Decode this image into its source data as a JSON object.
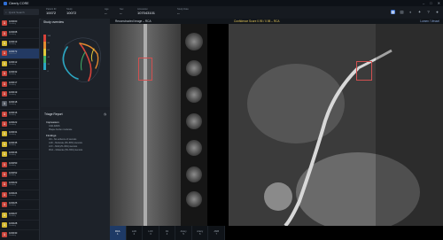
{
  "app": {
    "title": "Cleerly CORE"
  },
  "window": {
    "min": "–",
    "max": "□",
    "close": "✕"
  },
  "search": {
    "placeholder": "Quick Search"
  },
  "header": {
    "fields": [
      {
        "k": "Patient ID",
        "v": "10072"
      },
      {
        "k": "Study",
        "v": "10072"
      },
      {
        "k": "Age",
        "v": "--"
      },
      {
        "k": "Sex",
        "v": "--"
      },
      {
        "k": "Accession",
        "v": "107043101"
      },
      {
        "k": "Study Date",
        "v": "--"
      }
    ]
  },
  "patients": [
    {
      "id": "100000",
      "sub": "Pending",
      "color": "#c8433a"
    },
    {
      "id": "100008",
      "sub": "Pending",
      "color": "#c8433a"
    },
    {
      "id": "100013",
      "sub": "Pending",
      "color": "#d1b62e"
    },
    {
      "id": "100072",
      "sub": "Selected",
      "color": "#c8433a"
    },
    {
      "id": "100012",
      "sub": "Pending",
      "color": "#d1b62e"
    },
    {
      "id": "100032",
      "sub": "Pending",
      "color": "#c8433a"
    },
    {
      "id": "100017",
      "sub": "Pending",
      "color": "#c8433a"
    },
    {
      "id": "100019",
      "sub": "Pending",
      "color": "#c8433a"
    },
    {
      "id": "100018",
      "sub": "Pending",
      "color": "#555c66"
    },
    {
      "id": "100016",
      "sub": "Pending",
      "color": "#c8433a"
    },
    {
      "id": "100022",
      "sub": "Pending",
      "color": "#c8433a"
    },
    {
      "id": "100031",
      "sub": "Pending",
      "color": "#d1b62e"
    },
    {
      "id": "100045",
      "sub": "Pending",
      "color": "#d1b62e"
    },
    {
      "id": "100046",
      "sub": "Pending",
      "color": "#d1b62e"
    },
    {
      "id": "100050",
      "sub": "Pending",
      "color": "#c8433a"
    },
    {
      "id": "100052",
      "sub": "Pending",
      "color": "#c8433a"
    },
    {
      "id": "100023",
      "sub": "Pending",
      "color": "#c8433a"
    },
    {
      "id": "100024",
      "sub": "Pending",
      "color": "#c8433a"
    },
    {
      "id": "100025",
      "sub": "Pending",
      "color": "#c8433a"
    },
    {
      "id": "100027",
      "sub": "Pending",
      "color": "#d1b62e"
    },
    {
      "id": "100028",
      "sub": "Pending",
      "color": "#d1b62e"
    },
    {
      "id": "100030",
      "sub": "Pending",
      "color": "#c8433a"
    }
  ],
  "overview": {
    "title": "Study overview",
    "legend": [
      "0",
      "20",
      "40",
      "60",
      "80",
      "100"
    ]
  },
  "report": {
    "title": "Triage Report",
    "impression_title": "Impression",
    "impression": [
      "CAD-RADS",
      "Plaque burden moderate"
    ],
    "findings_title": "Findings",
    "findings": [
      "LM – No evidence of stenosis",
      "LAD – Moderate (50–69%) stenosis",
      "LCX – Mild (25–49%) stenosis",
      "RCA – Moderate (50–69%) stenosis"
    ]
  },
  "viewer": {
    "title": "Reconstructed Image – RCA",
    "center": "Confidence Score 0.95 / 0.98 – RCA",
    "right": "Lumen / Vessel",
    "tabs": [
      {
        "label": "RCA",
        "sub": "1"
      },
      {
        "label": "LAD",
        "sub": "2"
      },
      {
        "label": "LCX",
        "sub": "3"
      },
      {
        "label": "D1",
        "sub": "4"
      },
      {
        "label": "Artery",
        "sub": "5"
      },
      {
        "label": "Artery",
        "sub": "6"
      },
      {
        "label": "AMB",
        "sub": "7"
      }
    ]
  }
}
